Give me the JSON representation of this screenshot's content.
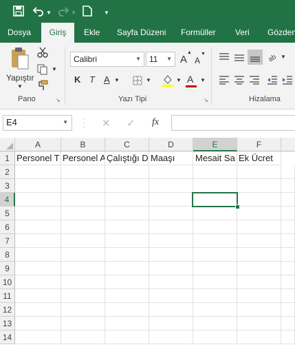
{
  "qat": {
    "icons": [
      "save-icon",
      "undo-icon",
      "redo-icon",
      "new-icon",
      "customize-icon"
    ]
  },
  "tabs": [
    "Dosya",
    "Giriş",
    "Ekle",
    "Sayfa Düzeni",
    "Formüller",
    "Veri",
    "Gözden"
  ],
  "active_tab": "Giriş",
  "ribbon": {
    "paste_label": "Yapıştır",
    "group_pano": "Pano",
    "group_font": "Yazı Tipi",
    "group_align": "Hizalama",
    "font_name": "Calibri",
    "font_size": "11",
    "bold": "K",
    "italic": "T",
    "underline": "A",
    "grow": "A",
    "shrink": "A",
    "font_color_letter": "A",
    "colors": {
      "highlight": "#ffff00",
      "font": "#c00000",
      "accent": "#217346"
    }
  },
  "formula_bar": {
    "name_box": "E4",
    "fx": "fx",
    "value": ""
  },
  "columns": [
    "A",
    "B",
    "C",
    "D",
    "E",
    "F"
  ],
  "rows": [
    "1",
    "2",
    "3",
    "4",
    "5",
    "6",
    "7",
    "8",
    "9",
    "10",
    "11",
    "12",
    "13",
    "14"
  ],
  "headers": [
    "Personel T",
    "Personel Ad",
    "Çalıştığı De",
    "Maaşı",
    "Mesait Sa",
    "Ek Ücret"
  ],
  "active_cell": "E4"
}
